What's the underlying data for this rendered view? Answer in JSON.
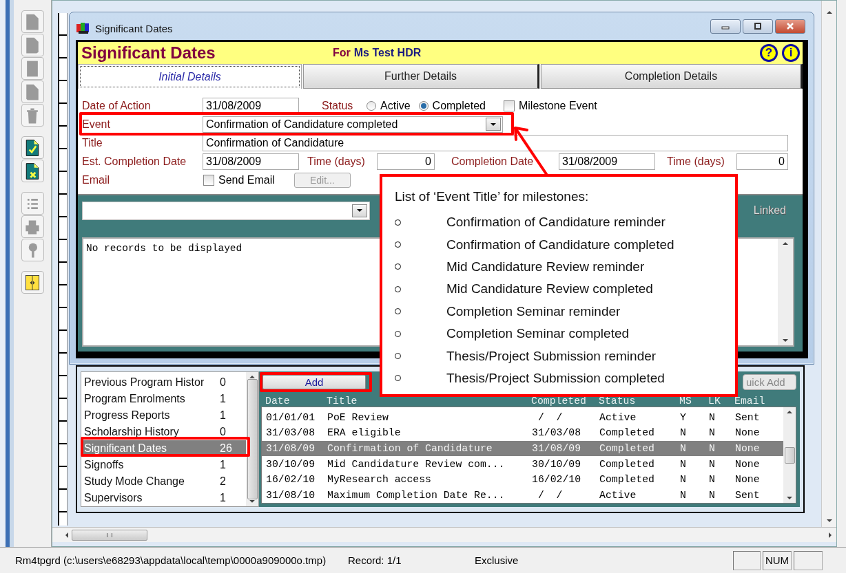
{
  "window": {
    "title": "Significant Dates"
  },
  "header": {
    "title": "Significant Dates",
    "for_label": "For",
    "person": "Ms Test HDR",
    "help_glyph": "?",
    "info_glyph": "i"
  },
  "tabs": [
    {
      "label": "Initial Details",
      "selected": true
    },
    {
      "label": "Further Details",
      "selected": false
    },
    {
      "label": "Completion Details",
      "selected": false
    }
  ],
  "form": {
    "date_of_action": {
      "label": "Date of Action",
      "value": "31/08/2009"
    },
    "status": {
      "label": "Status",
      "options": [
        {
          "label": "Active",
          "selected": false
        },
        {
          "label": "Completed",
          "selected": true
        }
      ]
    },
    "milestone_event": {
      "label": "Milestone Event",
      "checked": false
    },
    "event": {
      "label": "Event",
      "value": "Confirmation of Candidature completed"
    },
    "title": {
      "label": "Title",
      "value": "Confirmation of Candidature"
    },
    "est_completion_date": {
      "label": "Est. Completion Date",
      "value": "31/08/2009"
    },
    "time_days_1": {
      "label": "Time (days)",
      "value": "0"
    },
    "completion_date": {
      "label": "Completion Date",
      "value": "31/08/2009"
    },
    "time_days_2": {
      "label": "Time (days)",
      "value": "0"
    },
    "email": {
      "label": "Email"
    },
    "send_email": {
      "label": "Send Email",
      "checked": false
    },
    "edit_button": {
      "label": "Edit...",
      "disabled": true
    }
  },
  "records_panel": {
    "linked_label": "Linked",
    "empty_message": "No records to be displayed"
  },
  "side_list": {
    "items": [
      {
        "label": "Previous Program Histor",
        "count": "0",
        "selected": false
      },
      {
        "label": "Program Enrolments",
        "count": "1",
        "selected": false
      },
      {
        "label": "Progress Reports",
        "count": "1",
        "selected": false
      },
      {
        "label": "Scholarship History",
        "count": "0",
        "selected": false
      },
      {
        "label": "Significant Dates",
        "count": "26",
        "selected": true
      },
      {
        "label": "Signoffs",
        "count": "1",
        "selected": false
      },
      {
        "label": "Study Mode Change",
        "count": "2",
        "selected": false
      },
      {
        "label": "Supervisors",
        "count": "1",
        "selected": false
      }
    ]
  },
  "add_button": "Add",
  "quick_add_button": "uick Add",
  "table": {
    "columns": [
      "Date",
      "Title",
      "Completed",
      "Status",
      "MS",
      "LK",
      "Email"
    ],
    "rows": [
      {
        "cells": [
          "01/01/01",
          "PoE Review",
          " /  /",
          "Active",
          "Y",
          "N",
          "Sent"
        ],
        "selected": false
      },
      {
        "cells": [
          "31/03/08",
          "ERA eligible",
          "31/03/08",
          "Completed",
          "N",
          "N",
          "None"
        ],
        "selected": false
      },
      {
        "cells": [
          "31/08/09",
          "Confirmation of Candidature",
          "31/08/09",
          "Completed",
          "N",
          "N",
          "None"
        ],
        "selected": true
      },
      {
        "cells": [
          "30/10/09",
          "Mid Candidature Review com...",
          "30/10/09",
          "Completed",
          "N",
          "N",
          "None"
        ],
        "selected": false
      },
      {
        "cells": [
          "16/02/10",
          "MyResearch access",
          "16/02/10",
          "Completed",
          "N",
          "N",
          "None"
        ],
        "selected": false
      },
      {
        "cells": [
          "31/08/10",
          "Maximum Completion Date Re...",
          " /  /",
          "Active",
          "N",
          "N",
          "Sent"
        ],
        "selected": false
      }
    ]
  },
  "callout": {
    "title": "List of ‘Event Title’ for milestones:",
    "items": [
      "Confirmation of Candidature reminder",
      "Confirmation of Candidature completed",
      "Mid Candidature Review reminder",
      "Mid Candidature Review completed",
      "Completion Seminar reminder",
      "Completion Seminar completed",
      "Thesis/Project Submission reminder",
      "Thesis/Project Submission completed"
    ]
  },
  "status_bar": {
    "file": "Rm4tpgrd (c:\\users\\e68293\\appdata\\local\\temp\\0000a909000o.tmp)",
    "record": "Record: 1/1",
    "mode": "Exclusive",
    "num": "NUM"
  }
}
